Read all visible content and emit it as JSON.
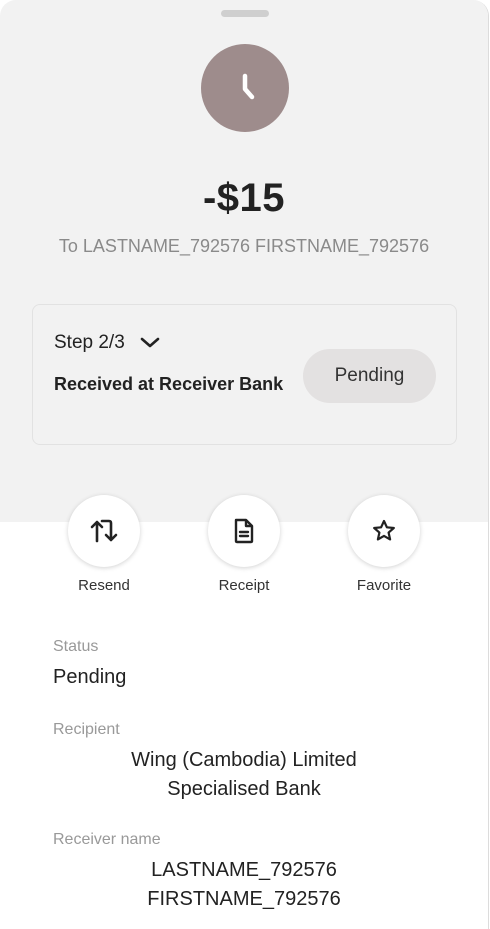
{
  "transaction": {
    "amount": "-$15",
    "to_line": "To LASTNAME_792576 FIRSTNAME_792576"
  },
  "status_card": {
    "step": "Step 2/3",
    "description": "Received at Receiver Bank",
    "badge": "Pending"
  },
  "actions": [
    {
      "label": "Resend",
      "icon": "repeat-icon"
    },
    {
      "label": "Receipt",
      "icon": "receipt-icon"
    },
    {
      "label": "Favorite",
      "icon": "star-icon"
    }
  ],
  "details": {
    "status_label": "Status",
    "status_value": "Pending",
    "recipient_label": "Recipient",
    "recipient_line1": "Wing (Cambodia) Limited",
    "recipient_line2": "Specialised Bank",
    "receiver_name_label": "Receiver name",
    "receiver_name_line1": "LASTNAME_792576",
    "receiver_name_line2": "FIRSTNAME_792576"
  },
  "colors": {
    "top_background": "#f2f2f2",
    "clock_circle": "#9e8c8c",
    "pill": "#e3e1e1",
    "muted_text": "#999999"
  }
}
